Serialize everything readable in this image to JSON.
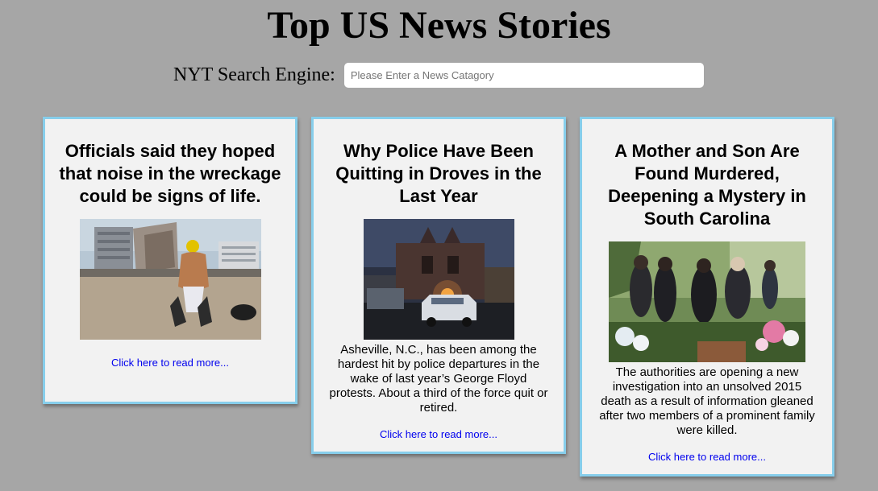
{
  "page": {
    "title": "Top US News Stories"
  },
  "search": {
    "label": "NYT Search Engine:",
    "placeholder": "Please Enter a News Catagory",
    "value": ""
  },
  "cards": [
    {
      "title": "Officials said they hoped that noise in the wreckage could be signs of life.",
      "summary": "",
      "link": "Click here to read more..."
    },
    {
      "title": "Why Police Have Been Quitting in Droves in the Last Year",
      "summary": "Asheville, N.C., has been among the hardest hit by police departures in the wake of last year’s George Floyd protests. About a third of the force quit or retired.",
      "link": "Click here to read more..."
    },
    {
      "title": "A Mother and Son Are Found Murdered, Deepening a Mystery in South Carolina",
      "summary": "The authorities are opening a new investigation into an unsolved 2015 death as a result of information gleaned after two members of a prominent family were killed.",
      "link": "Click here to read more..."
    }
  ],
  "colors": {
    "background": "#a6a6a6",
    "card_background": "#f2f2f2",
    "card_border": "#87ceeb",
    "link": "#0000ee"
  }
}
